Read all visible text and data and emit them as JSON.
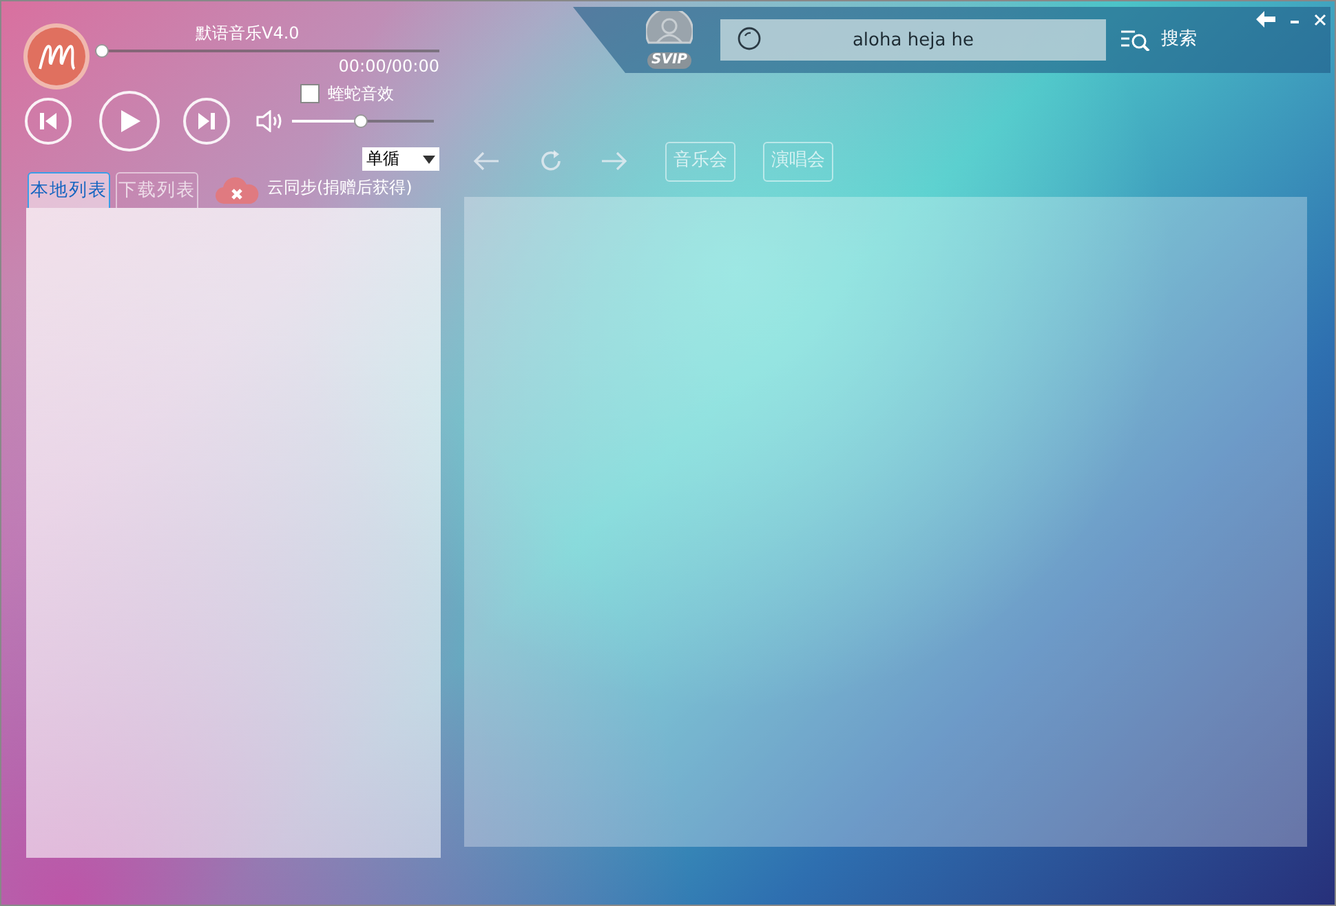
{
  "app": {
    "title": "默语音乐V4.0",
    "time": "00:00/00:00",
    "progress": {
      "level": 0
    },
    "volume": {
      "level": 0.48
    },
    "effect": {
      "label": "蝰蛇音效",
      "checked": false
    },
    "play_mode": "单循"
  },
  "tabs": [
    {
      "label": "本地列表",
      "selected": true
    },
    {
      "label": "下载列表",
      "selected": false
    }
  ],
  "cloud_sync": "云同步(捐赠后获得)",
  "account": {
    "badge": "SVIP"
  },
  "search": {
    "value": "aloha heja he",
    "button": "搜索"
  },
  "nav_buttons": [
    "音乐会",
    "演唱会"
  ]
}
